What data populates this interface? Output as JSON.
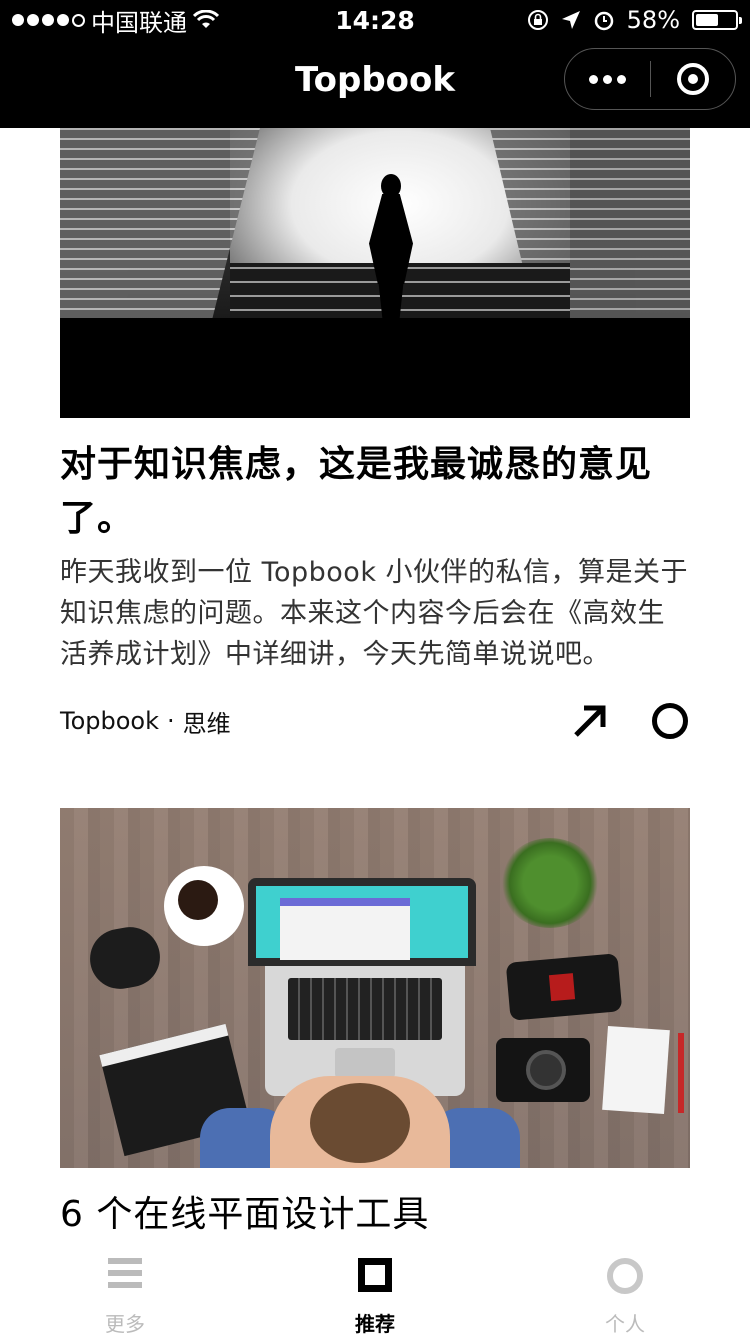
{
  "status_bar": {
    "carrier": "中国联通",
    "time": "14:28",
    "battery": "58%",
    "battery_level": 0.58,
    "icons": [
      "signal-dots-icon",
      "wifi-icon",
      "rotation-lock-icon",
      "location-icon",
      "alarm-icon",
      "battery-icon"
    ]
  },
  "nav": {
    "title": "Topbook",
    "icons": [
      "more-dots-icon",
      "close-target-icon"
    ]
  },
  "feed": {
    "articles": [
      {
        "title": "对于知识焦虑，这是我最诚恳的意见了。",
        "summary": "昨天我收到一位 Topbook 小伙伴的私信，算是关于知识焦虑的问题。本来这个内容今后会在《高效生活养成计划》中详细讲，今天先简单说说吧。",
        "author": "Topbook",
        "separator": "·",
        "category": "思维",
        "icons": [
          "share-arrow-icon",
          "favorite-circle-icon"
        ]
      },
      {
        "title": "6 个在线平面设计工具"
      }
    ]
  },
  "tabs": [
    {
      "label": "更多",
      "icon": "menu-icon",
      "active": false
    },
    {
      "label": "推荐",
      "icon": "square-icon",
      "active": true
    },
    {
      "label": "个人",
      "icon": "profile-circle-icon",
      "active": false
    }
  ]
}
